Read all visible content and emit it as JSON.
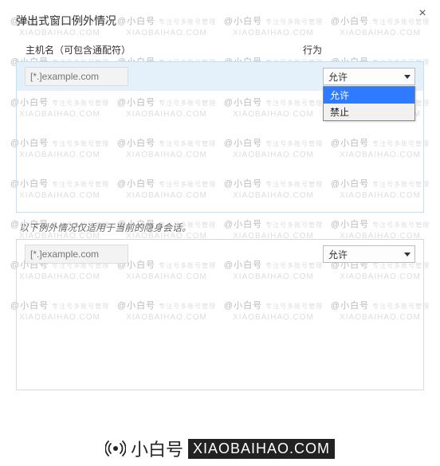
{
  "dialog": {
    "title": "弹出式窗口例外情况",
    "close_glyph": "×",
    "columns": {
      "host": "主机名（可包含通配符）",
      "action": "行为"
    },
    "top": {
      "host_placeholder": "[*.]example.com",
      "select_value": "允许",
      "dropdown": {
        "opt_allow": "允许",
        "opt_block": "禁止"
      }
    },
    "note": "以下例外情况仅适用于当前的隐身会话。",
    "bottom": {
      "host_placeholder": "[*.]example.com",
      "select_value": "允许"
    }
  },
  "watermark": {
    "top_cn": "@小白号",
    "top_sub": "专注号多账号管理",
    "bottom_en": "XIAOBAIHAO.COM"
  },
  "footer": {
    "brand_cn": "小白号",
    "brand_en": "XIAOBAIHAO.COM"
  }
}
